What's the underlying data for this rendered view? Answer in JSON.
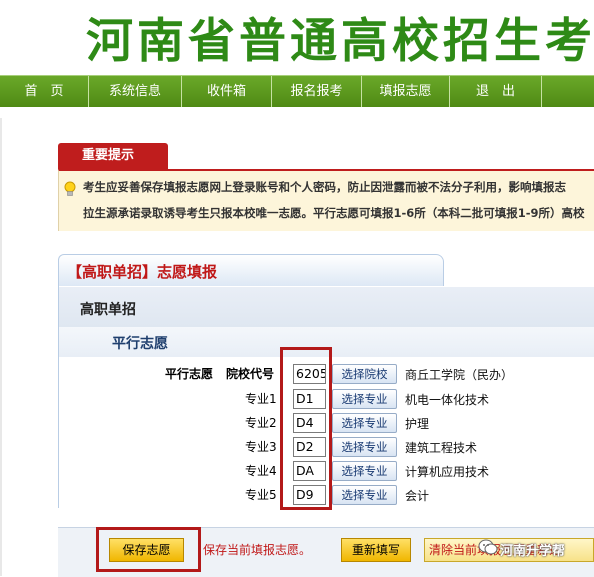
{
  "banner": {
    "title": "河南省普通高校招生考"
  },
  "nav": {
    "items": [
      {
        "label": "首　页"
      },
      {
        "label": "系统信息"
      },
      {
        "label": "收件箱"
      },
      {
        "label": "报名报考"
      },
      {
        "label": "填报志愿"
      },
      {
        "label": "退　出"
      }
    ]
  },
  "notice": {
    "tab": "重要提示",
    "line1": "考生应妥善保存填报志愿网上登录账号和个人密码，防止因泄露而被不法分子利用，影响填报志",
    "line2": "拉生源承诺录取诱导考生只报本校唯一志愿。平行志愿可填报1-6所（本科二批可填报1-9所）高校"
  },
  "panel": {
    "title": "【高职单招】志愿填报",
    "section": "高职单招",
    "subsection": "平行志愿"
  },
  "form": {
    "school": {
      "group_label": "平行志愿",
      "label": "院校代号",
      "code": "6205",
      "button": "选择院校",
      "name": "商丘工学院（民办）"
    },
    "majors": [
      {
        "label": "专业1",
        "code": "D1",
        "button": "选择专业",
        "name": "机电一体化技术"
      },
      {
        "label": "专业2",
        "code": "D4",
        "button": "选择专业",
        "name": "护理"
      },
      {
        "label": "专业3",
        "code": "D2",
        "button": "选择专业",
        "name": "建筑工程技术"
      },
      {
        "label": "专业4",
        "code": "DA",
        "button": "选择专业",
        "name": "计算机应用技术"
      },
      {
        "label": "专业5",
        "code": "D9",
        "button": "选择专业",
        "name": "会计"
      }
    ]
  },
  "actions": {
    "save": "保存志愿",
    "save_hint": "保存当前填报志愿。",
    "reset": "重新填写",
    "clear": "清除当前填报志愿重新选"
  },
  "watermark": {
    "text": "河南升学帮"
  },
  "colors": {
    "banner_title": "#2e8a16",
    "nav_bg": "#5b9a1e",
    "notice_red": "#bf1d1d",
    "highlight_red": "#b31919",
    "button_yellow": "#f0b600"
  }
}
